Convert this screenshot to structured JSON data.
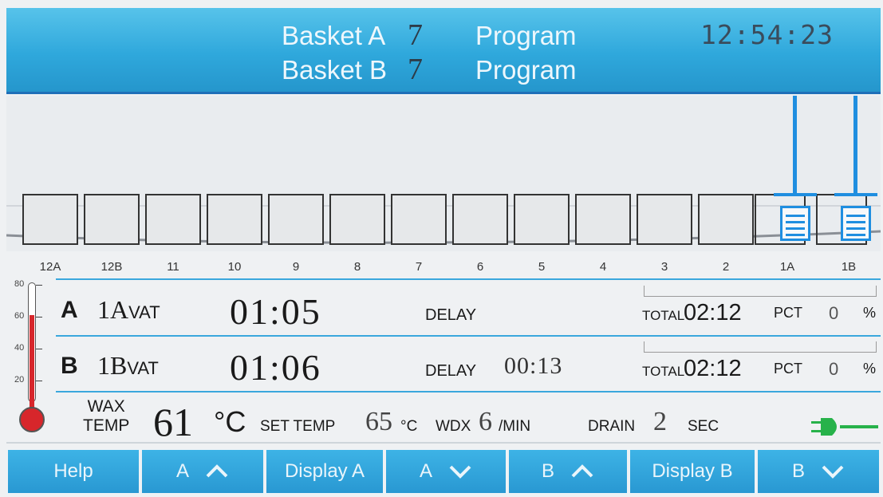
{
  "header": {
    "basket_a_label": "Basket A",
    "basket_a_num": "7",
    "basket_a_prog": "Program",
    "basket_b_label": "Basket B",
    "basket_b_num": "7",
    "basket_b_prog": "Program",
    "clock": "12:54:23"
  },
  "vats": [
    "12A",
    "12B",
    "11",
    "10",
    "9",
    "8",
    "7",
    "6",
    "5",
    "4",
    "3",
    "2",
    "1A",
    "1B"
  ],
  "thermometer": {
    "ticks": [
      "80",
      "60",
      "40",
      "20"
    ],
    "level": 61
  },
  "row_a": {
    "basket": "A",
    "vat": "1A",
    "vat_suffix": "VAT",
    "time": "01:05",
    "delay_label": "DELAY",
    "delay_value": "",
    "total_label": "TOTAL",
    "total_value": "02:12",
    "pct_label": "PCT",
    "pct_value": "0",
    "pct_unit": "%",
    "progress": 0
  },
  "row_b": {
    "basket": "B",
    "vat": "1B",
    "vat_suffix": "VAT",
    "time": "01:06",
    "delay_label": "DELAY",
    "delay_value": "00:13",
    "total_label": "TOTAL",
    "total_value": "02:12",
    "pct_label": "PCT",
    "pct_value": "0",
    "pct_unit": "%",
    "progress": 0
  },
  "wax": {
    "label_line1": "WAX",
    "label_line2": "TEMP",
    "temp": "61",
    "temp_unit": "°C",
    "set_label": "SET TEMP",
    "set_value": "65",
    "set_unit": "°C",
    "wdx_label": "WDX",
    "wdx_value": "6",
    "wdx_unit": "/MIN",
    "drain_label": "DRAIN",
    "drain_value": "2",
    "drain_unit": "SEC"
  },
  "buttons": {
    "help": "Help",
    "a_up": "A",
    "display_a": "Display A",
    "a_down": "A",
    "b_up": "B",
    "display_b": "Display B",
    "b_down": "B"
  },
  "colors": {
    "accent": "#2fa8dc",
    "hanger": "#1f8ee0",
    "mercury": "#d7262b"
  },
  "icons": [
    "chevron-up-icon",
    "chevron-down-icon",
    "plug-icon",
    "basket-icon",
    "thermometer-icon"
  ]
}
